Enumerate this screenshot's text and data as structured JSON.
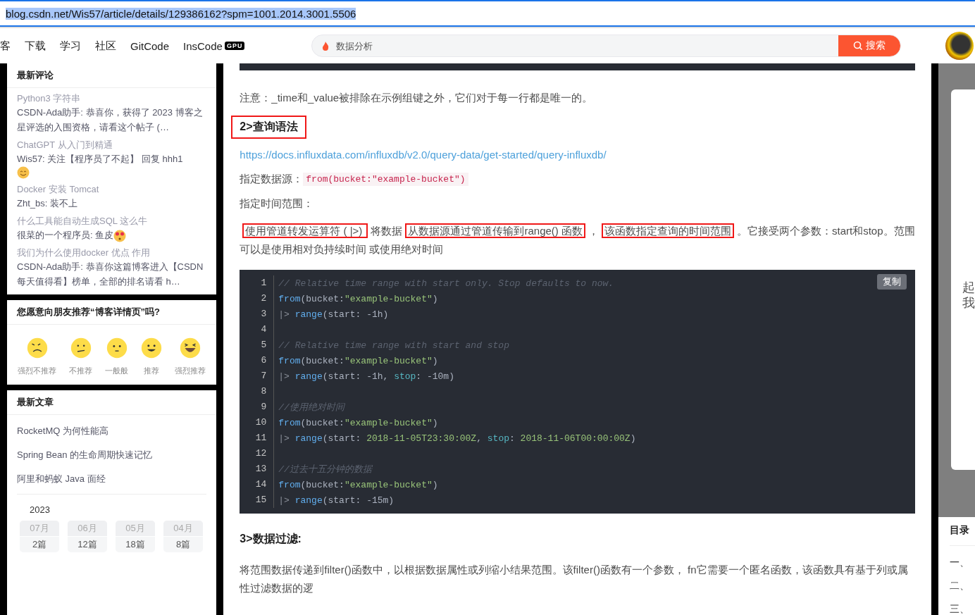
{
  "address_bar": {
    "url": "blog.csdn.net/Wis57/article/details/129386162?spm=1001.2014.3001.5506",
    "selected": true
  },
  "nav": {
    "items": [
      {
        "label": "客"
      },
      {
        "label": "下载"
      },
      {
        "label": "学习"
      },
      {
        "label": "社区"
      },
      {
        "label": "GitCode"
      },
      {
        "label": "InsCode",
        "badge": "GPU"
      }
    ],
    "search": {
      "placeholder": "数据分析",
      "button": "搜索"
    }
  },
  "sidebar": {
    "comments": {
      "title": "最新评论",
      "items": [
        {
          "article": "Python3 字符串",
          "text": "CSDN-Ada助手: 恭喜你，获得了 2023 博客之星评选的入围资格，请看这个帖子 (…"
        },
        {
          "article": "ChatGPT 从入门到精通",
          "text": "Wis57: 关注【程序员了不起】 回复 hhh1",
          "emoji": {
            "kind": "smile"
          }
        },
        {
          "article": "Docker 安装 Tomcat",
          "text": "Zht_bs: 装不上"
        },
        {
          "article": "什么工具能自动生成SQL 这么牛",
          "text": "很菜的一个程序员: 鱼皮",
          "emoji": {
            "kind": "love"
          }
        },
        {
          "article": "我们为什么使用docker 优点 作用",
          "text": "CSDN-Ada助手: 恭喜你这篇博客进入【CSDN每天值得看】榜单，全部的排名请看 h…"
        }
      ]
    },
    "rating": {
      "title": "您愿意向朋友推荐“博客详情页”吗?",
      "options": [
        {
          "label": "强烈不推荐",
          "kind": "angry"
        },
        {
          "label": "不推荐",
          "kind": "sad"
        },
        {
          "label": "一般般",
          "kind": "neutral"
        },
        {
          "label": "推荐",
          "kind": "happy"
        },
        {
          "label": "强烈推荐",
          "kind": "laugh"
        }
      ]
    },
    "articles": {
      "title": "最新文章",
      "items": [
        "RocketMQ 为何性能高",
        "Spring Bean 的生命周期快速记忆",
        "阿里和蚂蚁 Java 面经"
      ]
    },
    "archive": {
      "year": "2023",
      "months": [
        {
          "month": "07月",
          "count": "2篇"
        },
        {
          "month": "06月",
          "count": "12篇"
        },
        {
          "month": "05月",
          "count": "18篇"
        },
        {
          "month": "04月",
          "count": "8篇"
        }
      ]
    }
  },
  "article": {
    "note": "注意：_time和_value被排除在示例组键之外，它们对于每一行都是唯一的。",
    "heading_1": {
      "text": "2>查询语法",
      "boxed": true
    },
    "link": "https://docs.influxdata.com/influxdb/v2.0/query-data/get-started/query-influxdb/",
    "source_label": "指定数据源：",
    "source_code": "from(bucket:\"example-bucket\")",
    "range_label": "指定时间范围：",
    "range_paragraph": [
      {
        "text": "使用管道转发运算符 ( |>) ",
        "boxed": true
      },
      {
        "text": "将数据",
        "boxed": false
      },
      {
        "text": "从数据源通过管道传输到range() 函数",
        "boxed": true
      },
      {
        "text": "，",
        "boxed": false
      },
      {
        "text": "该函数指定查询的时间范围",
        "boxed": true
      },
      {
        "text": "。它接受两个参数：start和stop。范围可以是使用相对负持续时间 或使用绝对时间",
        "boxed": false
      }
    ],
    "copy_button": "复制",
    "code": [
      {
        "number": "1",
        "tokens": [
          {
            "kind": "comment",
            "text": "// Relative time range with start only. Stop defaults to now."
          }
        ]
      },
      {
        "number": "2",
        "tokens": [
          {
            "kind": "func",
            "text": "from"
          },
          {
            "kind": "plain",
            "text": "(bucket:"
          },
          {
            "kind": "string",
            "text": "\"example-bucket\""
          },
          {
            "kind": "plain",
            "text": ")"
          }
        ]
      },
      {
        "number": "3",
        "tokens": [
          {
            "kind": "op",
            "text": "|> "
          },
          {
            "kind": "func",
            "text": "range"
          },
          {
            "kind": "plain",
            "text": "(start: -1h)"
          }
        ]
      },
      {
        "number": "4"
      },
      {
        "number": "5",
        "tokens": [
          {
            "kind": "comment",
            "text": "// Relative time range with start and stop"
          }
        ]
      },
      {
        "number": "6",
        "tokens": [
          {
            "kind": "func",
            "text": "from"
          },
          {
            "kind": "plain",
            "text": "(bucket:"
          },
          {
            "kind": "string",
            "text": "\"example-bucket\""
          },
          {
            "kind": "plain",
            "text": ")"
          }
        ]
      },
      {
        "number": "7",
        "tokens": [
          {
            "kind": "op",
            "text": "|> "
          },
          {
            "kind": "func",
            "text": "range"
          },
          {
            "kind": "plain",
            "text": "(start: -1h, "
          },
          {
            "kind": "key",
            "text": "stop"
          },
          {
            "kind": "plain",
            "text": ": -10m)"
          }
        ]
      },
      {
        "number": "8"
      },
      {
        "number": "9",
        "tokens": [
          {
            "kind": "comment",
            "text": "//使用绝对时间"
          }
        ]
      },
      {
        "number": "10",
        "tokens": [
          {
            "kind": "func",
            "text": "from"
          },
          {
            "kind": "plain",
            "text": "(bucket:"
          },
          {
            "kind": "string",
            "text": "\"example-bucket\""
          },
          {
            "kind": "plain",
            "text": ")"
          }
        ]
      },
      {
        "number": "11",
        "tokens": [
          {
            "kind": "op",
            "text": "|> "
          },
          {
            "kind": "func",
            "text": "range"
          },
          {
            "kind": "plain",
            "text": "(start: "
          },
          {
            "kind": "string",
            "text": "2018-11-05T23:30:00Z"
          },
          {
            "kind": "plain",
            "text": ", "
          },
          {
            "kind": "key",
            "text": "stop"
          },
          {
            "kind": "plain",
            "text": ": "
          },
          {
            "kind": "string",
            "text": "2018-11-06T00:00:00Z"
          },
          {
            "kind": "plain",
            "text": ")"
          }
        ]
      },
      {
        "number": "12"
      },
      {
        "number": "13",
        "tokens": [
          {
            "kind": "comment",
            "text": "//过去十五分钟的数据"
          }
        ]
      },
      {
        "number": "14",
        "tokens": [
          {
            "kind": "func",
            "text": "from"
          },
          {
            "kind": "plain",
            "text": "(bucket:"
          },
          {
            "kind": "string",
            "text": "\"example-bucket\""
          },
          {
            "kind": "plain",
            "text": ")"
          }
        ]
      },
      {
        "number": "15",
        "tokens": [
          {
            "kind": "op",
            "text": "|> "
          },
          {
            "kind": "func",
            "text": "range"
          },
          {
            "kind": "plain",
            "text": "(start: -15m)"
          }
        ]
      }
    ],
    "heading_2": "3>数据过滤:",
    "filter_paragraph": "将范围数据传递到filter()函数中，以根据数据属性或列缩小结果范围。该filter()函数有一个参数， fn它需要一个匿名函数，该函数具有基于列或属性过滤数据的逻"
  },
  "right_panel": {
    "card_lines": [
      "起",
      "我"
    ],
    "toc_title": "目录",
    "toc_items": [
      "一、",
      "二、",
      "三、"
    ]
  }
}
